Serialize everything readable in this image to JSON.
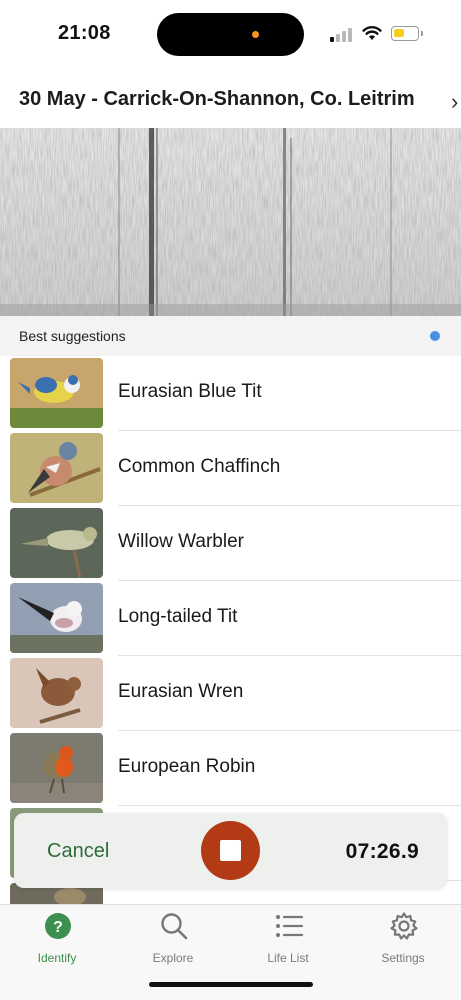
{
  "status_bar": {
    "time": "21:08",
    "battery_color": "#f5cf1c",
    "recording_dot_color": "#f39a1e"
  },
  "header": {
    "title": "30 May - Carrick-On-Shannon, Co. Leitrim"
  },
  "suggestions": {
    "label": "Best suggestions",
    "indicator_color": "#4a90e2",
    "items": [
      {
        "name": "Eurasian Blue Tit",
        "image": "blue-tit-photo"
      },
      {
        "name": "Common Chaffinch",
        "image": "chaffinch-photo"
      },
      {
        "name": "Willow Warbler",
        "image": "willow-warbler-photo"
      },
      {
        "name": "Long-tailed Tit",
        "image": "long-tailed-tit-photo"
      },
      {
        "name": "Eurasian Wren",
        "image": "wren-photo"
      },
      {
        "name": "European Robin",
        "image": "robin-photo"
      }
    ]
  },
  "recorder": {
    "cancel_label": "Cancel",
    "elapsed": "07:26.9",
    "stop_color": "#b23a14"
  },
  "tab_bar": {
    "active_color": "#3c8f4d",
    "tabs": [
      {
        "label": "Identify",
        "icon": "identify-icon",
        "active": true
      },
      {
        "label": "Explore",
        "icon": "search-icon",
        "active": false
      },
      {
        "label": "Life List",
        "icon": "list-icon",
        "active": false
      },
      {
        "label": "Settings",
        "icon": "gear-icon",
        "active": false
      }
    ]
  }
}
